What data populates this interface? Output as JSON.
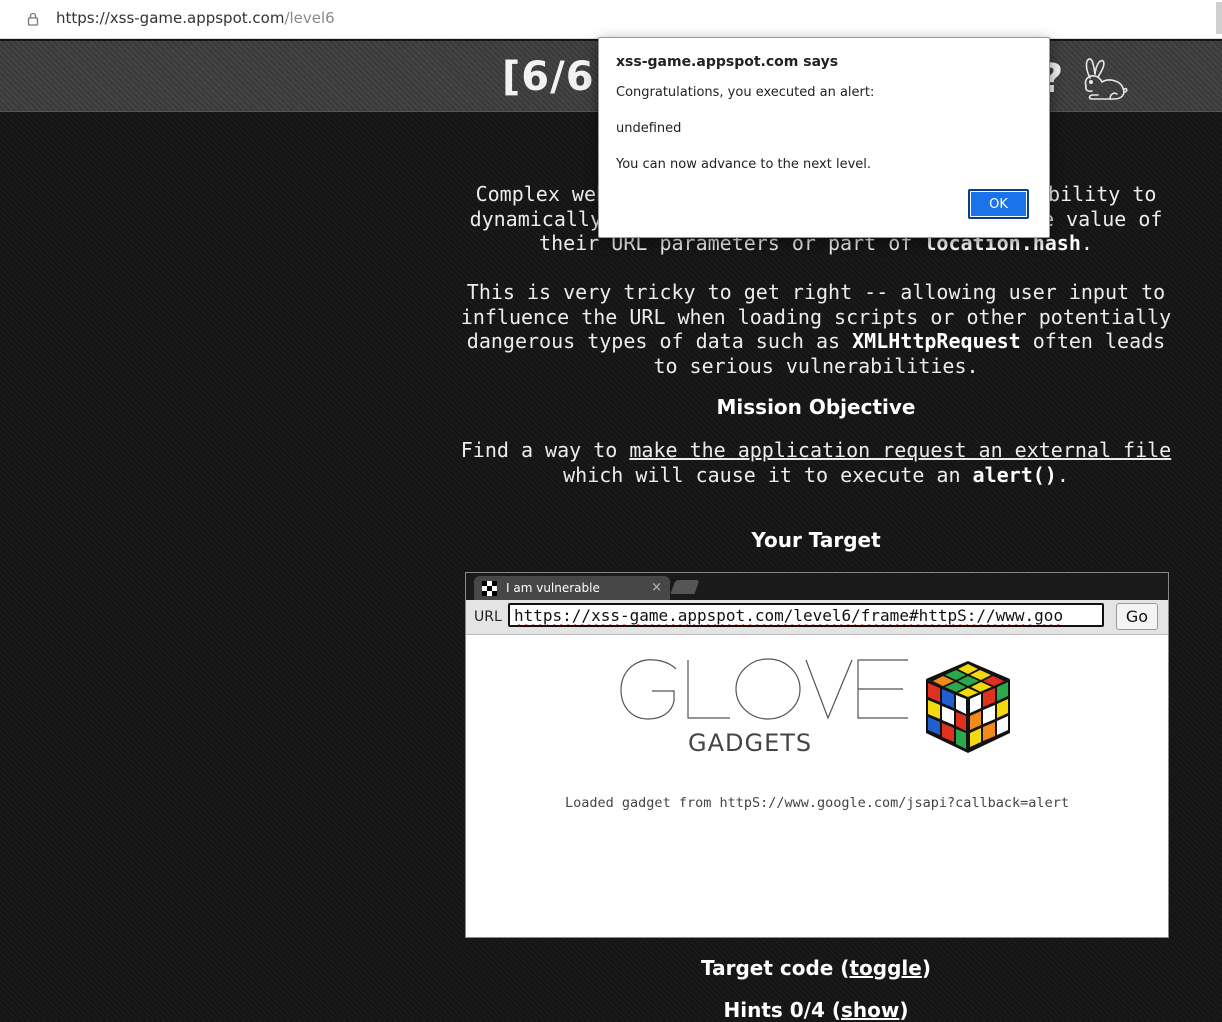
{
  "browser": {
    "url_host": "https://xss-game.appspot.com",
    "url_path": "/level6"
  },
  "header": {
    "title_left": "[6/6",
    "title_right": "?"
  },
  "intro": {
    "p1_a": "Complex web",
    "p1_b": "bility to",
    "p1_c": "dynamically",
    "p1_d": "e value of",
    "p1_e": "their URL parameters or part of",
    "p1_code": "location.hash",
    "p1_end": ".",
    "p2_a": "This is very tricky to get right -- allowing user input to influence the URL when loading scripts or other potentially dangerous types of data such as",
    "p2_code": "XMLHttpRequest",
    "p2_b": "often leads to serious vulnerabilities."
  },
  "mission": {
    "heading": "Mission Objective",
    "text_a": "Find a way to",
    "link": "make the application request an external file",
    "text_b": "which will cause it to execute an",
    "code": "alert()",
    "text_end": "."
  },
  "target": {
    "heading": "Your Target",
    "tab_label": "I am vulnerable",
    "tab_close": "×",
    "url_label": "URL",
    "url_value": "https://xss-game.appspot.com/level6/frame#httpS://www.goo",
    "go_label": "Go",
    "logo_text": "GLOVE",
    "logo_sub": "GADGETS",
    "loaded_message": "Loaded gadget from httpS://www.google.com/jsapi?callback=alert"
  },
  "footer": {
    "target_code_label": "Target code (",
    "target_code_link": "toggle",
    "target_code_end": ")",
    "hints_label": "Hints 0/4 (",
    "hints_link": "show",
    "hints_end": ")"
  },
  "dialog": {
    "title": "xss-game.appspot.com says",
    "line1": "Congratulations, you executed an alert:",
    "line2": "undefined",
    "line3": "You can now advance to the next level.",
    "ok_label": "OK"
  },
  "colors": {
    "ok_button": "#1a73e8",
    "page_background": "#141414",
    "header_background": "#3a3a3a"
  }
}
